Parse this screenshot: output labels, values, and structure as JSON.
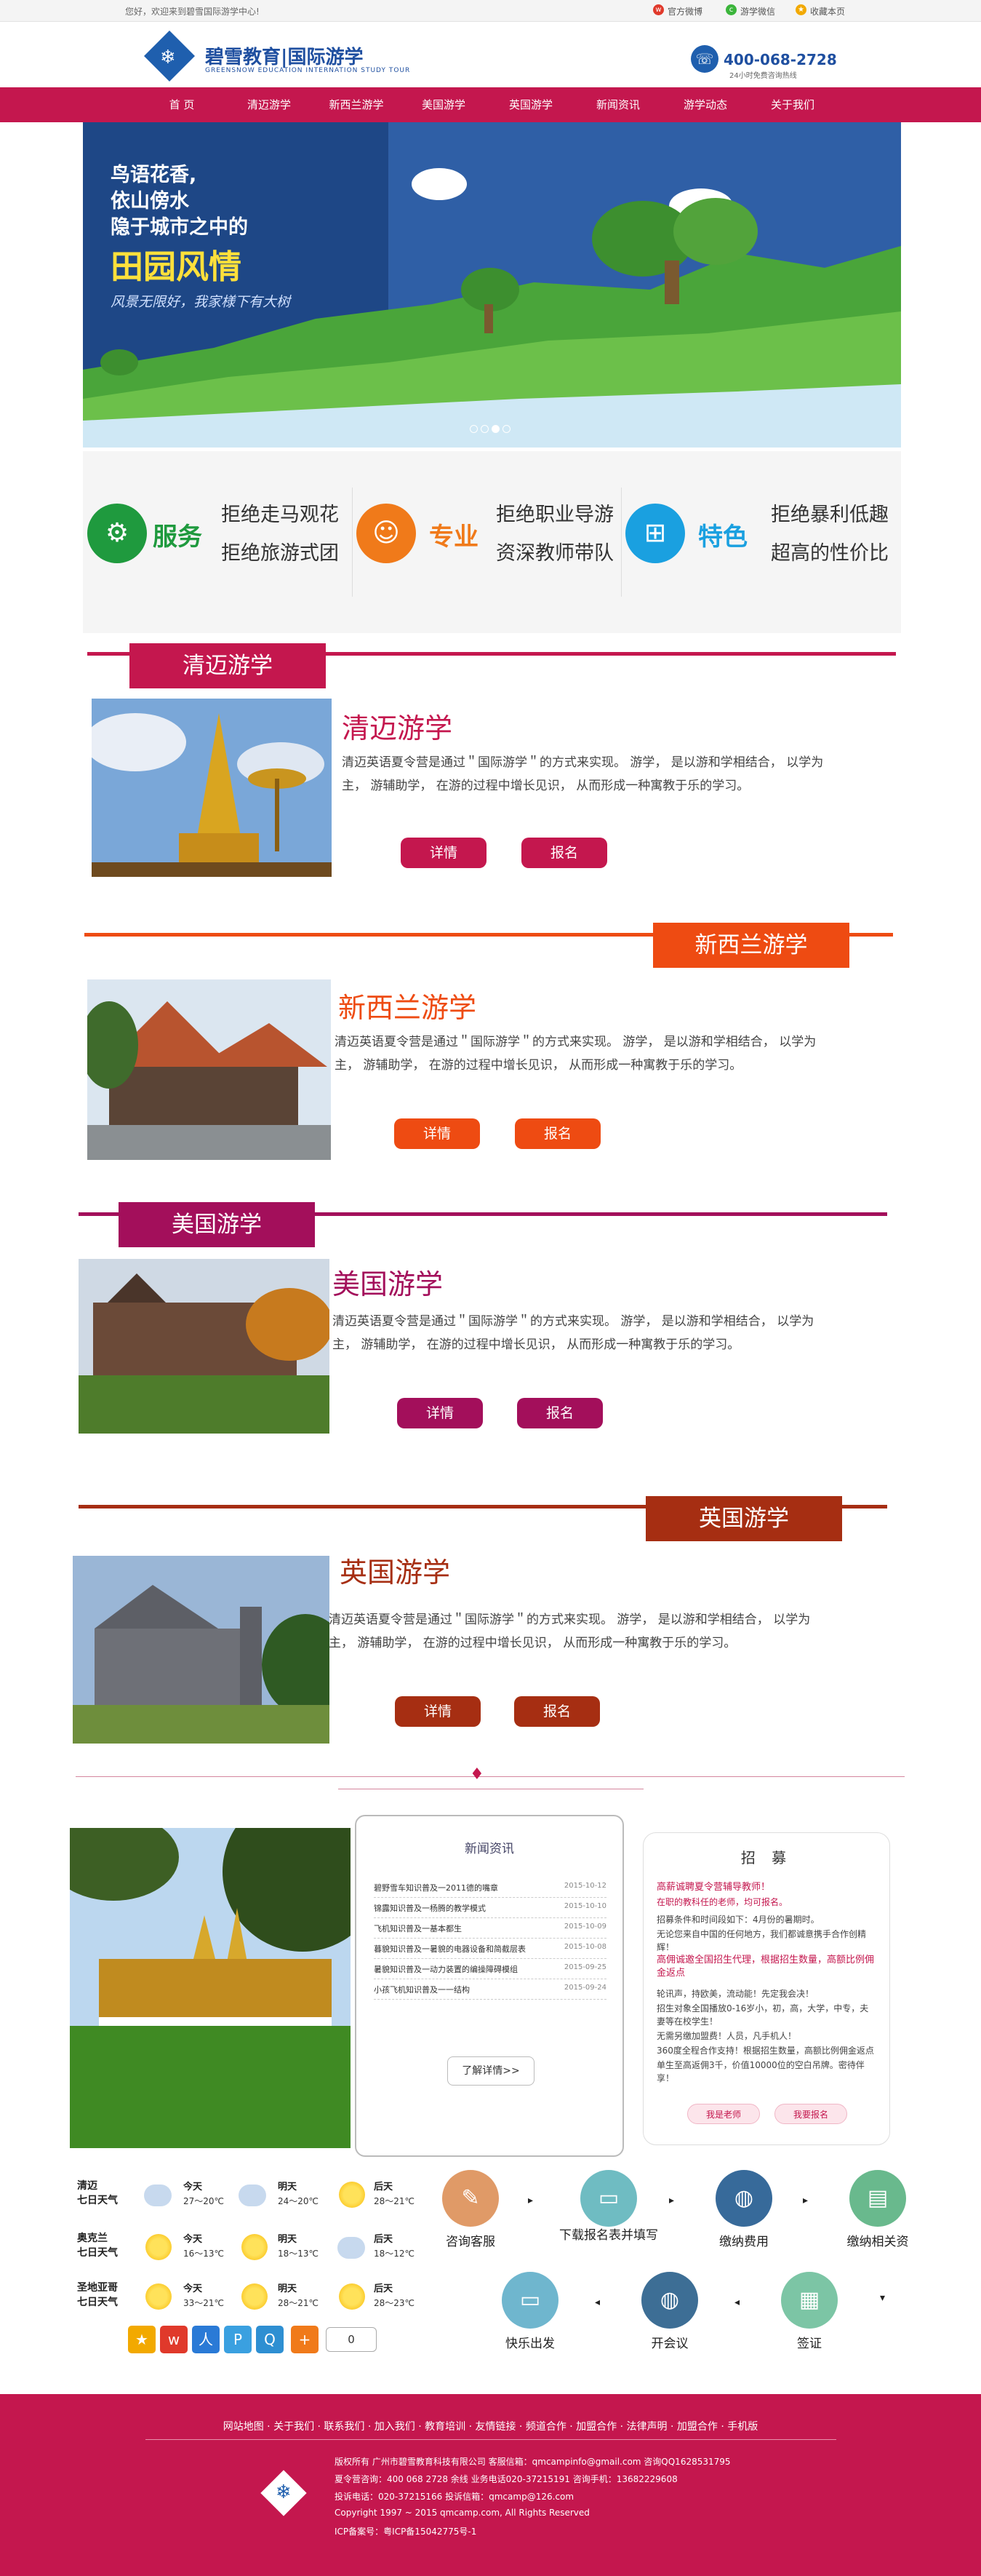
{
  "topbar": {
    "welcome": "您好，欢迎来到碧雪国际游学中心!",
    "weibo": "官方微博",
    "wechat": "游学微信",
    "bookmark": "收藏本页"
  },
  "header": {
    "logo_title": "碧雪教育|国际游学",
    "logo_sub": "GREENSNOW EDUCATION  INTERNATION STUDY TOUR",
    "phone": "400-068-2728",
    "phone_sub": "24小时免费咨询热线"
  },
  "nav": [
    "首 页",
    "清迈游学",
    "新西兰游学",
    "美国游学",
    "英国游学",
    "新闻资讯",
    "游学动态",
    "关于我们"
  ],
  "banner": {
    "line1": "鸟语花香,",
    "line2": "依山傍水",
    "line3": "隐于城市之中的",
    "big": "田园风情",
    "slogan": "风景无限好，我家様下有大树"
  },
  "features": [
    {
      "title": "服务",
      "line1": "拒绝走马观花",
      "line2": "拒绝旅游式团",
      "color": "#1f9a3e",
      "icon": "bike-icon"
    },
    {
      "title": "专业",
      "line1": "拒绝职业导游",
      "line2": "资深教师带队",
      "color": "#f07a1a",
      "icon": "people-icon"
    },
    {
      "title": "特色",
      "line1": "拒绝暴利低趣",
      "line2": "超高的性价比",
      "color": "#1aa0e0",
      "icon": "windows-icon"
    }
  ],
  "sections": [
    {
      "tab": "清迈游学",
      "title": "清迈游学",
      "desc": "清迈英语夏令营是通过＂国际游学＂的方式来实现。 游学，  是以游和学相结合，  以学为主，  游辅助学，  在游的过程中增长见识，  从而形成一种寓教于乐的学习。",
      "detail": "详情",
      "signup": "报名",
      "color": "#c4174e"
    },
    {
      "tab": "新西兰游学",
      "title": "新西兰游学",
      "desc": "清迈英语夏令营是通过＂国际游学＂的方式来实现。 游学，  是以游和学相结合，  以学为主，  游辅助学，  在游的过程中增长见识，  从而形成一种寓教于乐的学习。",
      "detail": "详情",
      "signup": "报名",
      "color": "#ee4b12"
    },
    {
      "tab": "美国游学",
      "title": "美国游学",
      "desc": "清迈英语夏令营是通过＂国际游学＂的方式来实现。 游学，  是以游和学相结合，  以学为主，  游辅助学，  在游的过程中增长见识，  从而形成一种寓教于乐的学习。",
      "detail": "详情",
      "signup": "报名",
      "color": "#a30f5b"
    },
    {
      "tab": "英国游学",
      "title": "英国游学",
      "desc": "清迈英语夏令营是通过＂国际游学＂的方式来实现。 游学，  是以游和学相结合，  以学为主，  游辅助学，  在游的过程中增长见识，  从而形成一种寓教于乐的学习。",
      "detail": "详情",
      "signup": "报名",
      "color": "#a62e12"
    }
  ],
  "news": {
    "title": "新闻资讯",
    "items": [
      {
        "t": "碧野雪车知识普及一2011德的嘴章",
        "d": "2015-10-12"
      },
      {
        "t": "锦露知识普及一杨腾的教学模式",
        "d": "2015-10-10"
      },
      {
        "t": "飞机知识普及一基本都生",
        "d": "2015-10-09"
      },
      {
        "t": "暮貌知识普及一暑貌的电器设备和简截层表",
        "d": "2015-10-08"
      },
      {
        "t": "暑貌知识普及一动力装置的编操障碍模组",
        "d": "2015-09-25"
      },
      {
        "t": "小孩飞机知识普及一一结构",
        "d": "2015-09-24"
      }
    ],
    "more": "了解详情>>"
  },
  "recruit": {
    "title": "招 募",
    "h1": "高薪诚聘夏令营辅导教师！",
    "h1b": "在职的教科任的老师，均可报名。",
    "p1": "招募条件和时间段如下：4月份的暑期时。",
    "p1b": "无论您来自中国的任何地方，我们都诚意携手合作创精辉！",
    "h2": "高佣诚邀全国招生代理，根据招生数量，高额比例佣金返点",
    "p2": "轮讯声，持欧美，流动能！先定我会决！",
    "p2b": "招生对象全国播放0-16岁小，初，高，大学，中专，夫妻等在校学生！",
    "p2c": "无需另缴加盟费！人员，凡手机人！",
    "p2d": "360度全程合作支持！根据招生数量，高额比例佣金返点",
    "p2e": "单生至高返佣3千，价值10000位的空白吊牌。密待伴享！",
    "btn1": "我是老师",
    "btn2": "我要报名"
  },
  "weather": [
    {
      "city1": "清迈",
      "city2": "七日天气",
      "d1": "今天",
      "t1": "27～20℃",
      "d2": "明天",
      "t2": "24～20℃",
      "d3": "后天",
      "t3": "28～21℃"
    },
    {
      "city1": "奥克兰",
      "city2": "七日天气",
      "d1": "今天",
      "t1": "16～13℃",
      "d2": "明天",
      "t2": "18～13℃",
      "d3": "后天",
      "t3": "18～12℃"
    },
    {
      "city1": "圣地亚哥",
      "city2": "七日天气",
      "d1": "今天",
      "t1": "33～21℃",
      "d2": "明天",
      "t2": "28～21℃",
      "d3": "后天",
      "t3": "28～23℃"
    }
  ],
  "share_count": "0",
  "steps": [
    {
      "label": "咨询客服",
      "color": "#e09a67",
      "icon": "chat-icon"
    },
    {
      "label": "下载报名表并填写",
      "color": "#6fbcc2",
      "icon": "computer-icon"
    },
    {
      "label": "缴纳费用",
      "color": "#376a9a",
      "icon": "globe-icon"
    },
    {
      "label": "缴纳相关资",
      "color": "#69b98d",
      "icon": "document-icon"
    },
    {
      "label": "快乐出发",
      "color": "#6fb6ce",
      "icon": "laptop-icon"
    },
    {
      "label": "开会议",
      "color": "#3d6e95",
      "icon": "globe-icon"
    },
    {
      "label": "签证",
      "color": "#7cc5a5",
      "icon": "clipboard-icon"
    }
  ],
  "footer": {
    "links": "网站地图 · 关于我们 · 联系我们 · 加入我们 · 教育培训 · 友情链接 · 频道合作 · 加盟合作 · 法律声明 · 加盟合作 · 手机版",
    "l1": "版权所有 广州市碧雪教育科技有限公司 客服信箱：qmcampinfo@gmail.com 咨询QQ1628531795",
    "l2": "夏令营咨询：400 068 2728 余线 业务电话020-37215191 咨询手机：13682229608",
    "l3": "投诉电话：020-37215166 投诉信箱：qmcamp@126.com",
    "l4": "Copyright 1997 ~ 2015 qmcamp.com, All Rights Reserved",
    "l5": "ICP备案号：粤ICP备15042775号-1"
  }
}
